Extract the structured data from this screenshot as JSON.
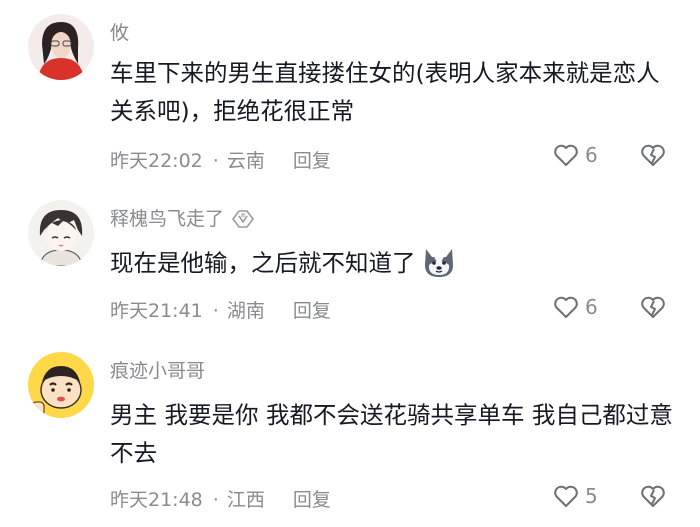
{
  "comments": [
    {
      "username": "攸",
      "text": "车里下来的男生直接搂住女的(表明人家本来就是恋人关系吧)，拒绝花很正常",
      "time": "昨天22:02",
      "location": "云南",
      "reply_label": "回复",
      "likes": "6",
      "avatar": "avatar-woman-red-jacket"
    },
    {
      "username": "释槐鸟飞走了",
      "text": "现在是他输，之后就不知道了",
      "time": "昨天21:41",
      "location": "湖南",
      "reply_label": "回复",
      "likes": "6",
      "avatar": "avatar-anime-girl"
    },
    {
      "username": "痕迹小哥哥",
      "text": "男主  我要是你  我都不会送花骑共享单车  我自己都过意不去",
      "time": "昨天21:48",
      "location": "江西",
      "reply_label": "回复",
      "likes": "5",
      "avatar": "avatar-cartoon-boy"
    }
  ],
  "icons": {
    "like": "heart-outline-icon",
    "dislike": "broken-heart-icon",
    "emoji": "husky-dog-emoji",
    "badge": "fan-badge-icon"
  },
  "colors": {
    "text_primary": "#161823",
    "text_secondary": "#8a8b91",
    "icon_gray": "#6f7075"
  }
}
